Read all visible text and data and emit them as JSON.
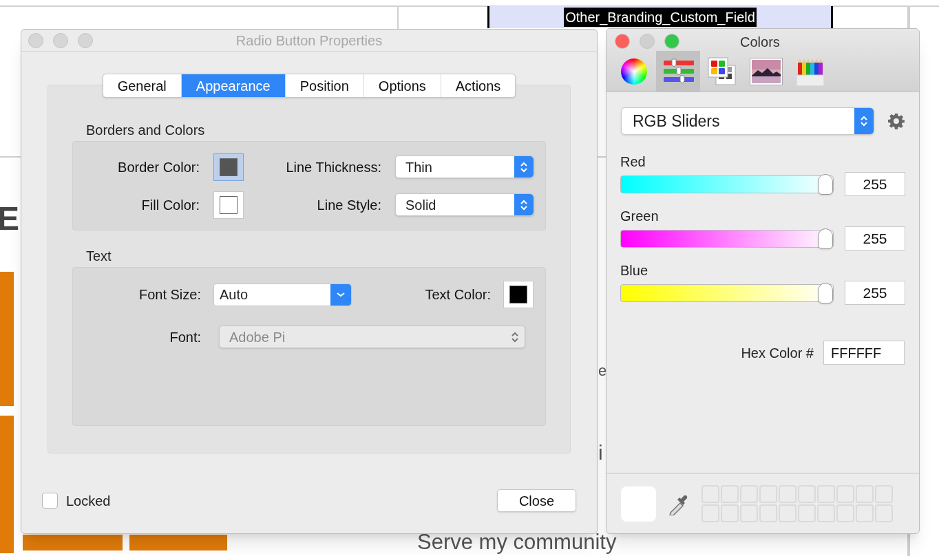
{
  "background": {
    "field_label": "Other_Branding_Custom_Field",
    "heading_fragment": "E",
    "fragments": [
      "e",
      "i"
    ],
    "body_text": "Serve my community"
  },
  "dialog": {
    "title": "Radio Button Properties",
    "active": false,
    "tabs": [
      {
        "label": "General",
        "selected": false
      },
      {
        "label": "Appearance",
        "selected": true
      },
      {
        "label": "Position",
        "selected": false
      },
      {
        "label": "Options",
        "selected": false
      },
      {
        "label": "Actions",
        "selected": false
      }
    ],
    "borders": {
      "title": "Borders and Colors",
      "border_color": {
        "label": "Border Color:",
        "color": "#555555",
        "selected": true
      },
      "fill_color": {
        "label": "Fill Color:",
        "color": "#ffffff",
        "selected": false
      },
      "line_thickness": {
        "label": "Line Thickness:",
        "value": "Thin"
      },
      "line_style": {
        "label": "Line Style:",
        "value": "Solid"
      }
    },
    "text": {
      "title": "Text",
      "font_size": {
        "label": "Font Size:",
        "value": "Auto"
      },
      "text_color": {
        "label": "Text Color:",
        "color": "#000000",
        "selected": false
      },
      "font": {
        "label": "Font:",
        "value": "Adobe Pi",
        "disabled": true
      }
    },
    "locked": {
      "label": "Locked",
      "checked": false
    },
    "close_button": "Close"
  },
  "colors": {
    "title": "Colors",
    "active": true,
    "modes": [
      {
        "kind": "wheel",
        "selected": false
      },
      {
        "kind": "sliders",
        "selected": true
      },
      {
        "kind": "palettes",
        "selected": false
      },
      {
        "kind": "image",
        "selected": false
      },
      {
        "kind": "pencils",
        "selected": false
      }
    ],
    "mode_select": "RGB Sliders",
    "sliders": [
      {
        "label": "Red",
        "color": "#00ffff",
        "level": 1,
        "value": "255"
      },
      {
        "label": "Green",
        "color": "#ff00ff",
        "level": 1,
        "value": "255"
      },
      {
        "label": "Blue",
        "color": "#ffff00",
        "level": 1,
        "value": "255"
      }
    ],
    "hex": {
      "label": "Hex Color #",
      "value": "FFFFFF"
    }
  }
}
